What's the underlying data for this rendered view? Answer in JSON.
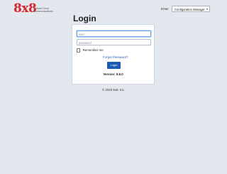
{
  "brand": {
    "logo_text": "8x8",
    "tagline": "Global Cloud Communications"
  },
  "header": {
    "enter_label": "Enter",
    "enter_select_value": "Configuration Manager"
  },
  "login": {
    "title": "Login",
    "user_placeholder": "user",
    "password_placeholder": "password",
    "remember_label": "Remember me",
    "forgot_link": "Forgot Password?",
    "submit_label": "Login",
    "version_text": "Version: 9.8.0"
  },
  "footer": {
    "copyright": "© 2020 8x8, Inc."
  },
  "colors": {
    "brand_red": "#d7262e",
    "primary_button": "#1a5bb8",
    "link": "#2a5db0",
    "page_background": "#e3e7ee"
  }
}
